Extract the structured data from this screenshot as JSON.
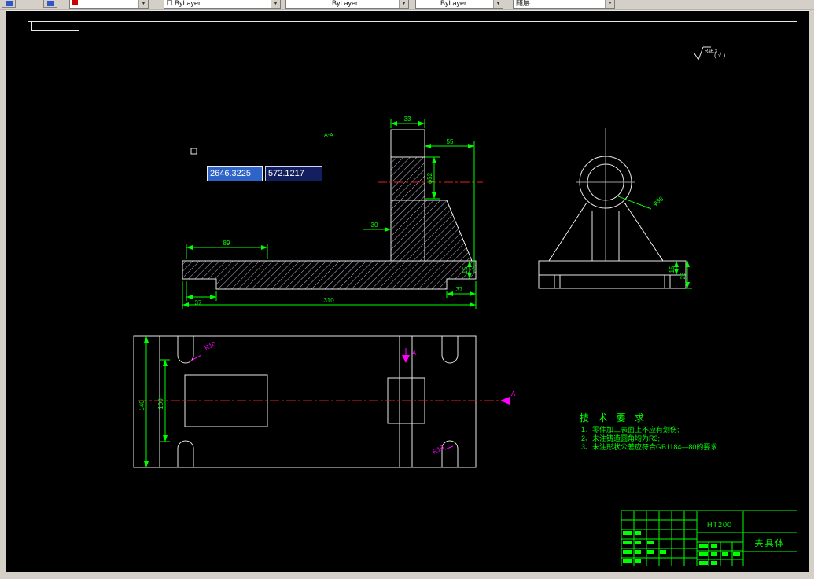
{
  "toolbar": {
    "color_value": "ByLayer",
    "linetype_value": "ByLayer",
    "lineweight_value": "ByLayer",
    "plot_style_value": "随层"
  },
  "dynamic_input": {
    "x_value": "2646.3225",
    "y_value": "572.1217"
  },
  "surface_finish": {
    "roughness": "Ra6.3",
    "bracket_check": "( √ )"
  },
  "front_view": {
    "section_label": "A-A",
    "dims": {
      "w33": "33",
      "w55": "55",
      "dia52": "φ52",
      "d30": "30",
      "w89": "89",
      "w37_left": "37",
      "w310": "310",
      "w37_right": "37",
      "h15": "15"
    }
  },
  "side_view": {
    "dims": {
      "dia38": "φ38",
      "h15": "15",
      "h28": "28"
    }
  },
  "plan_view": {
    "dims": {
      "h140": "140",
      "h100": "100",
      "r10_top": "R10",
      "r10_bottom": "R10"
    },
    "section_marks": {
      "right": "A",
      "top": "A"
    }
  },
  "tech_requirements": {
    "title": "技 术 要 求",
    "items": [
      "1、零件加工表面上不应有划伤;",
      "2、未注铸造圆角均为R3;",
      "3、未注形状公差应符合GB1184—80的要求."
    ]
  },
  "title_block": {
    "material": "HT200",
    "part_name": "夹具体"
  }
}
